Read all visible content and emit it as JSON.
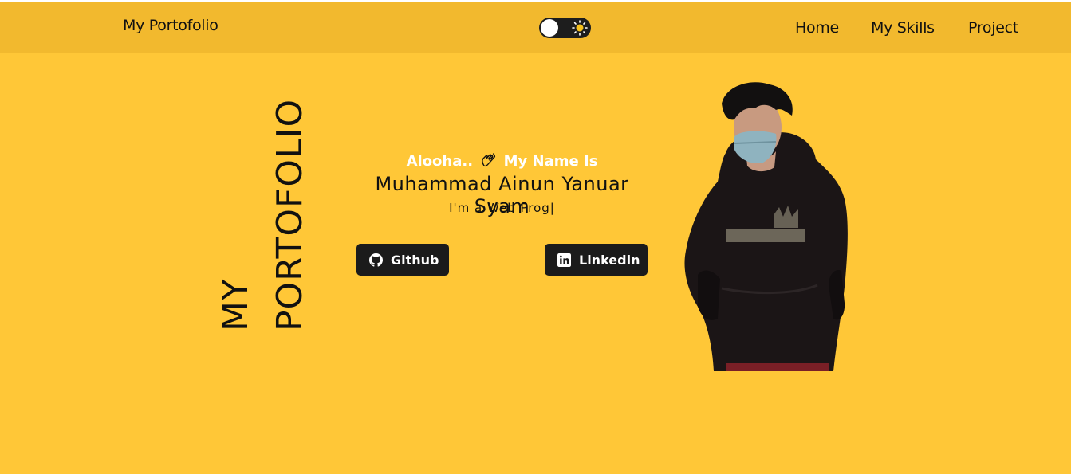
{
  "navbar": {
    "brand": "My Portofolio",
    "links": [
      "Home",
      "My Skills",
      "Project"
    ],
    "theme_toggle_icon": "sun-icon"
  },
  "hero": {
    "vertical_title": {
      "line1": "MY",
      "line2": "PORTOFOLIO"
    },
    "greeting_before": "Alooha..",
    "greeting_after": "My Name Is",
    "name": "Muhammad Ainun Yanuar Syam",
    "typed": "I'm a Web Prog|",
    "buttons": {
      "github": "Github",
      "linkedin": "Linkedin"
    }
  },
  "colors": {
    "background": "#ffc737",
    "navbar": "#f2b92e",
    "button": "#1b1b1b",
    "text": "#111111"
  }
}
